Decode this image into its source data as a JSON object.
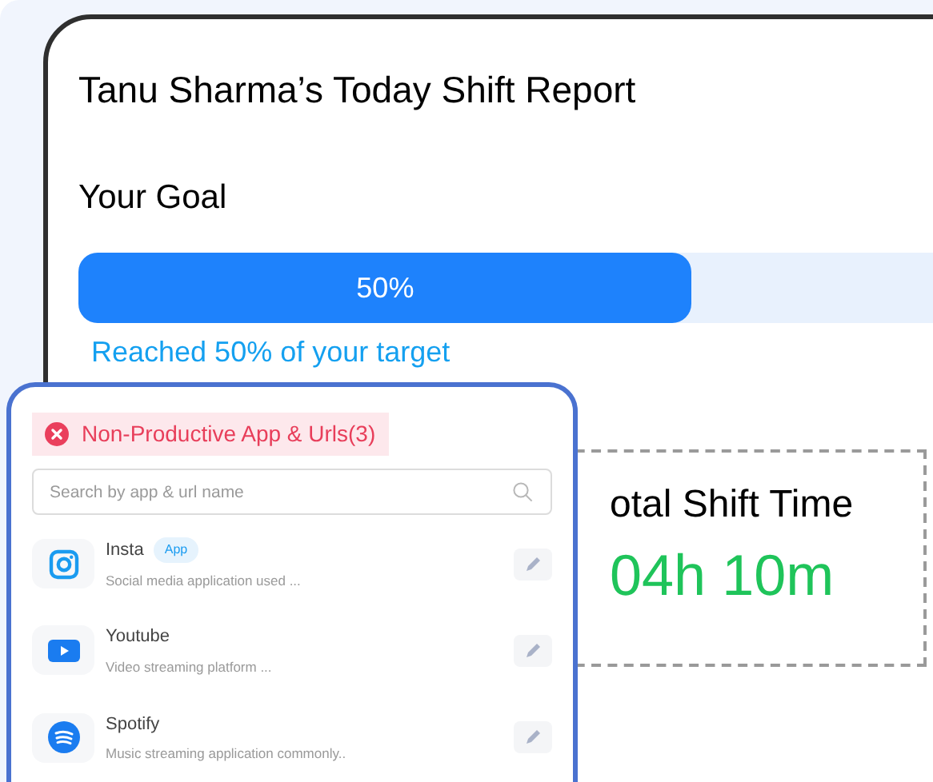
{
  "report": {
    "title": "Tanu Sharma’s Today Shift Report",
    "goal_label": "Your Goal",
    "goal_bar": {
      "level": 0.71,
      "reading": "50%"
    },
    "goal_note": "Reached 50% of your target",
    "shift_time": {
      "label": "otal Shift Time",
      "value": "04h 10m"
    }
  },
  "panel": {
    "header": "Non-Productive App & Urls(3)",
    "search": {
      "placeholder": "Search by app & url name"
    },
    "apps": [
      {
        "kind": "camera",
        "name": "Insta",
        "badge": "App",
        "description": "Social media application used ..."
      },
      {
        "kind": "video",
        "name": "Youtube",
        "description": "Video streaming platform ..."
      },
      {
        "kind": "music",
        "name": "Spotify",
        "description": "Music streaming application commonly.."
      }
    ]
  }
}
